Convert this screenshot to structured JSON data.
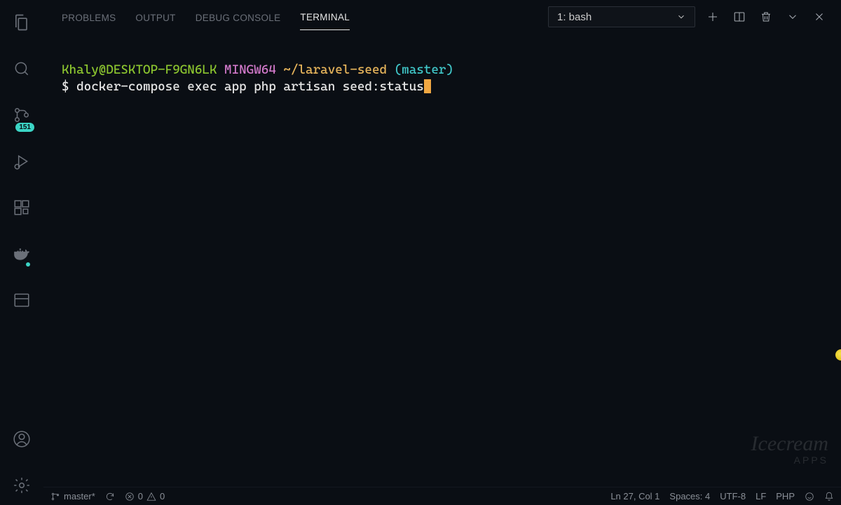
{
  "activity_bar": {
    "source_control_badge": "151"
  },
  "panel": {
    "tabs": {
      "problems": "PROBLEMS",
      "output": "OUTPUT",
      "debug_console": "DEBUG CONSOLE",
      "terminal": "TERMINAL"
    },
    "terminal_selector": "1: bash"
  },
  "terminal": {
    "prompt": {
      "user_host": "Khaly@DESKTOP-F9GN6LK",
      "shell_env": "MINGW64",
      "cwd": "~/laravel-seed",
      "branch_open": "(",
      "branch": "master",
      "branch_close": ")",
      "symbol": "$ ",
      "command": "docker-compose exec app php artisan seed:status"
    }
  },
  "status_bar": {
    "branch": "master*",
    "errors": "0",
    "warnings": "0",
    "line_col": "Ln 27, Col 1",
    "spaces": "Spaces: 4",
    "encoding": "UTF-8",
    "eol": "LF",
    "language": "PHP"
  },
  "watermark": {
    "main": "Icecream",
    "sub": "APPS"
  }
}
